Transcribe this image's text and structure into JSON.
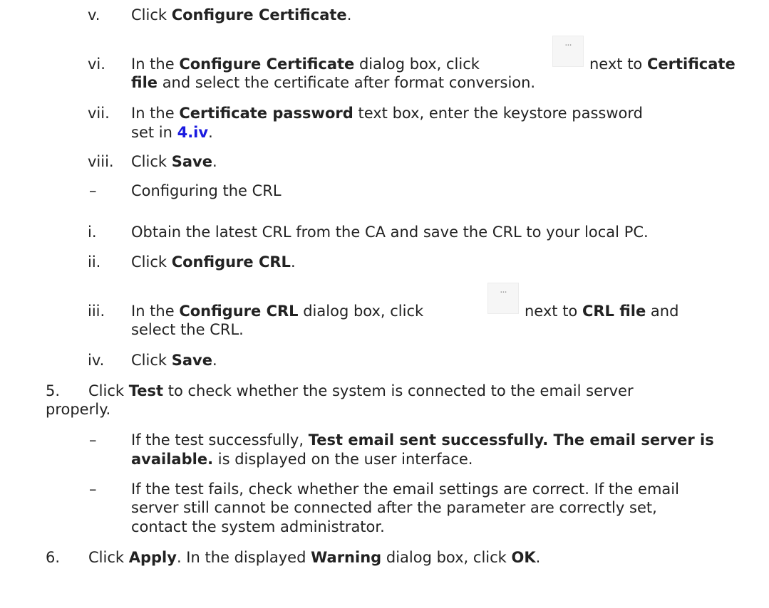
{
  "steps_sub": {
    "v": {
      "marker": "v.",
      "pre": "Click ",
      "bold": "Configure Certificate",
      "post": "."
    },
    "vi": {
      "marker": "vi.",
      "pre": "In the ",
      "bold1": "Configure Certificate",
      "mid1": " dialog box, click ",
      "icon": "more-icon",
      "icon_glyph": "···",
      "mid2": " next to ",
      "bold2": "Certificate",
      "bold3": "file",
      "post": " and select the certificate after format conversion."
    },
    "vii": {
      "marker": "vii.",
      "pre": "In the ",
      "bold": "Certificate password",
      "post": " text box, enter the keystore password",
      "pre2": "set in ",
      "link": "4.iv",
      "post2": "."
    },
    "viii": {
      "marker": "viii.",
      "pre": "Click ",
      "bold": "Save",
      "post": "."
    }
  },
  "crl_section": {
    "dash": "–",
    "title": "Configuring the CRL",
    "i": {
      "marker": "i.",
      "text": "Obtain the latest CRL from the CA and save the CRL to your local PC."
    },
    "ii": {
      "marker": "ii.",
      "pre": "Click ",
      "bold": "Configure CRL",
      "post": "."
    },
    "iii": {
      "marker": "iii.",
      "pre": "In the ",
      "bold1": "Configure CRL",
      "mid1": " dialog box, click ",
      "icon_glyph": "···",
      "mid2": " next to ",
      "bold2": "CRL file",
      "post": " and",
      "line2": "select the CRL."
    },
    "iv": {
      "marker": "iv.",
      "pre": "Click ",
      "bold": "Save",
      "post": "."
    }
  },
  "step5": {
    "marker": "5.",
    "pre": "Click ",
    "bold": "Test",
    "post": " to check whether the system is connected to the email server",
    "line2": "properly.",
    "bullet1": {
      "dash": "–",
      "pre": "If the test successfully, ",
      "bold": "Test email sent successfully. The email server is",
      "bold2": "available.",
      "post": " is displayed on the user interface."
    },
    "bullet2": {
      "dash": "–",
      "line1": "If the test fails, check whether the email settings are correct. If the email",
      "line2": "server still cannot be connected after the parameter are correctly set,",
      "line3": "contact the system administrator."
    }
  },
  "step6": {
    "marker": "6.",
    "pre": "Click ",
    "bold1": "Apply",
    "mid1": ". In the displayed ",
    "bold2": "Warning",
    "mid2": " dialog box, click ",
    "bold3": "OK",
    "post": "."
  }
}
